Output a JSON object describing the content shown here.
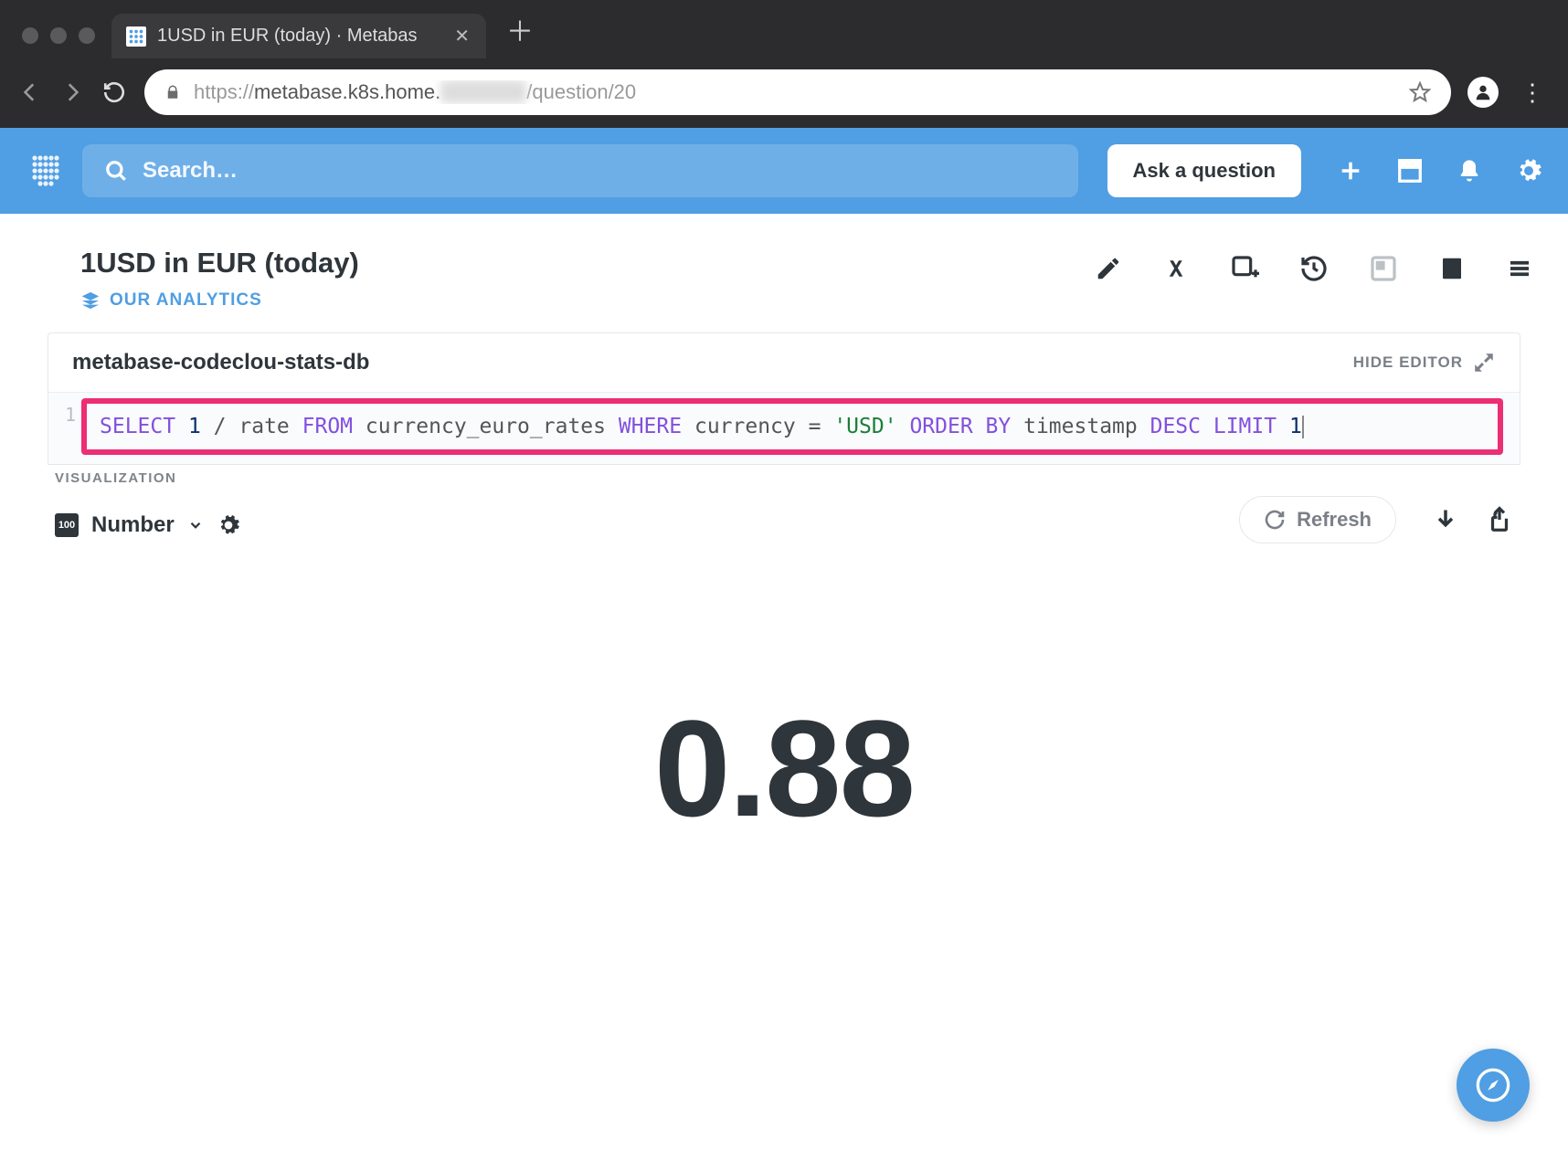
{
  "browser": {
    "tab_title": "1USD in EUR (today) · Metabas",
    "url_prefix": "https://",
    "url_host": "metabase.k8s.home.",
    "url_path": "/question/20"
  },
  "header": {
    "search_placeholder": "Search…",
    "ask_label": "Ask a question"
  },
  "question": {
    "title": "1USD in EUR (today)",
    "collection": "OUR ANALYTICS"
  },
  "editor": {
    "db": "metabase-codeclou-stats-db",
    "hide_label": "HIDE EDITOR",
    "line": "1",
    "sql_tokens": [
      {
        "t": "kw",
        "v": "SELECT"
      },
      {
        "t": "sp"
      },
      {
        "t": "num",
        "v": "1"
      },
      {
        "t": "sp"
      },
      {
        "t": "id",
        "v": "/"
      },
      {
        "t": "sp"
      },
      {
        "t": "id",
        "v": "rate"
      },
      {
        "t": "sp"
      },
      {
        "t": "kw",
        "v": "FROM"
      },
      {
        "t": "sp"
      },
      {
        "t": "id",
        "v": "currency_euro_rates"
      },
      {
        "t": "sp"
      },
      {
        "t": "kw",
        "v": "WHERE"
      },
      {
        "t": "sp"
      },
      {
        "t": "id",
        "v": "currency"
      },
      {
        "t": "sp"
      },
      {
        "t": "id",
        "v": "="
      },
      {
        "t": "sp"
      },
      {
        "t": "str",
        "v": "'USD'"
      },
      {
        "t": "sp"
      },
      {
        "t": "kw",
        "v": "ORDER"
      },
      {
        "t": "sp"
      },
      {
        "t": "kw",
        "v": "BY"
      },
      {
        "t": "sp"
      },
      {
        "t": "id",
        "v": "timestamp"
      },
      {
        "t": "sp"
      },
      {
        "t": "kw",
        "v": "DESC"
      },
      {
        "t": "sp"
      },
      {
        "t": "kw",
        "v": "LIMIT"
      },
      {
        "t": "sp"
      },
      {
        "t": "num",
        "v": "1"
      }
    ]
  },
  "viz": {
    "label": "VISUALIZATION",
    "type": "Number",
    "refresh": "Refresh"
  },
  "result": {
    "value": "0.88"
  }
}
